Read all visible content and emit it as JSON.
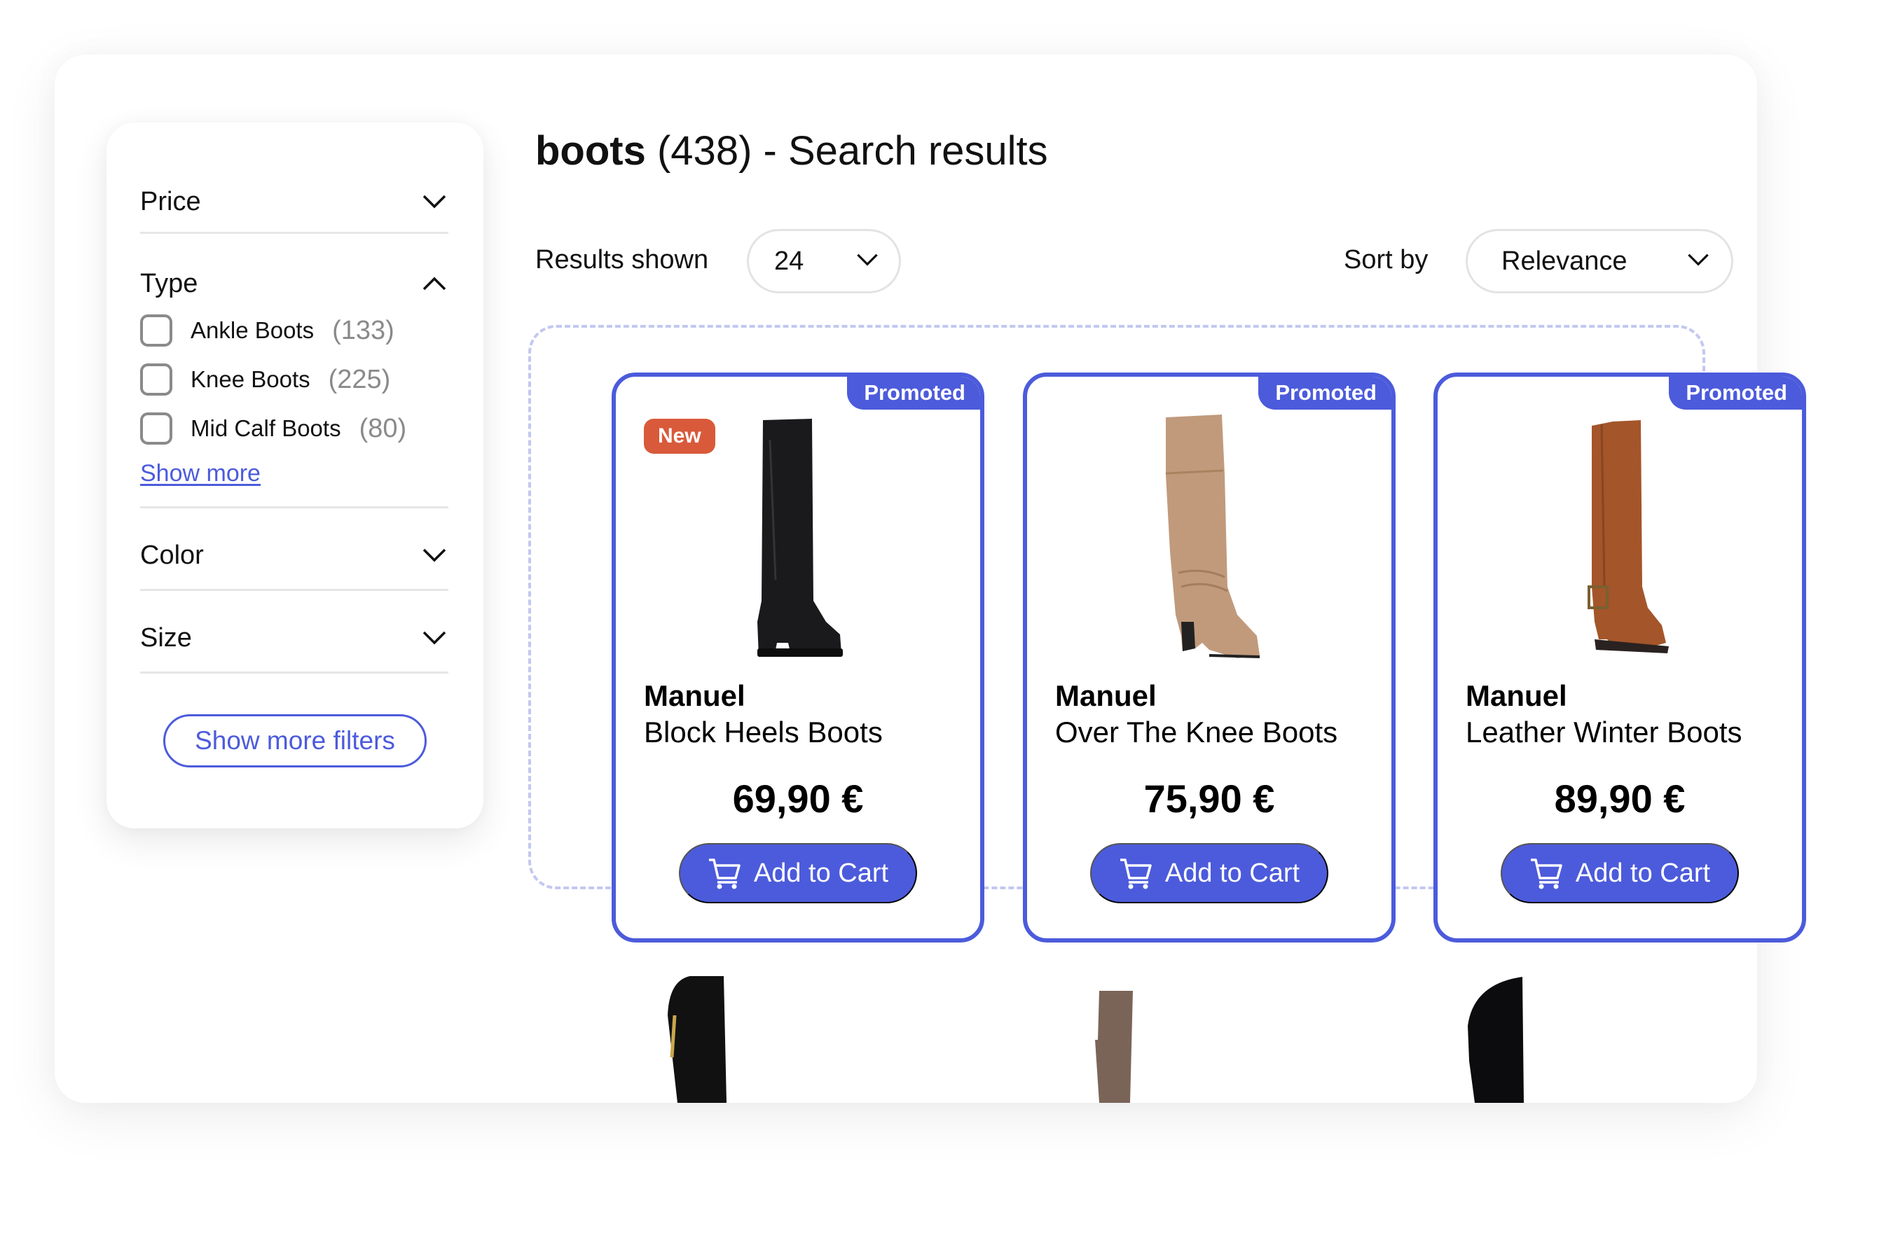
{
  "search": {
    "query": "boots",
    "count": "(438)",
    "suffix": "- Search results"
  },
  "toolbar": {
    "results_label": "Results shown",
    "results_value": "24",
    "sort_label": "Sort by",
    "sort_value": "Relevance"
  },
  "filters": {
    "price": {
      "label": "Price",
      "expanded": false
    },
    "type": {
      "label": "Type",
      "expanded": true,
      "options": [
        {
          "label": "Ankle Boots",
          "count": "(133)",
          "checked": false
        },
        {
          "label": "Knee Boots",
          "count": "(225)",
          "checked": false
        },
        {
          "label": "Mid Calf Boots",
          "count": "(80)",
          "checked": false
        }
      ],
      "show_more": "Show more"
    },
    "color": {
      "label": "Color",
      "expanded": false
    },
    "size": {
      "label": "Size",
      "expanded": false
    },
    "show_more_filters": "Show more filters"
  },
  "products": [
    {
      "badge_promoted": "Promoted",
      "badge_new": "New",
      "brand": "Manuel",
      "name": "Block Heels Boots",
      "price": "69,90 €",
      "cta": "Add to Cart",
      "boot_color": "#1a1a1c"
    },
    {
      "badge_promoted": "Promoted",
      "brand": "Manuel",
      "name": "Over The Knee Boots",
      "price": "75,90 €",
      "cta": "Add to Cart",
      "boot_color": "#c19a7c"
    },
    {
      "badge_promoted": "Promoted",
      "brand": "Manuel",
      "name": "Leather Winter Boots",
      "price": "89,90 €",
      "cta": "Add to Cart",
      "boot_color": "#a4552a"
    }
  ],
  "colors": {
    "accent": "#4C5BDB",
    "new_badge": "#D85A3A",
    "dashed_outline": "#C3C8F0",
    "muted_text": "#8A8A8A"
  }
}
